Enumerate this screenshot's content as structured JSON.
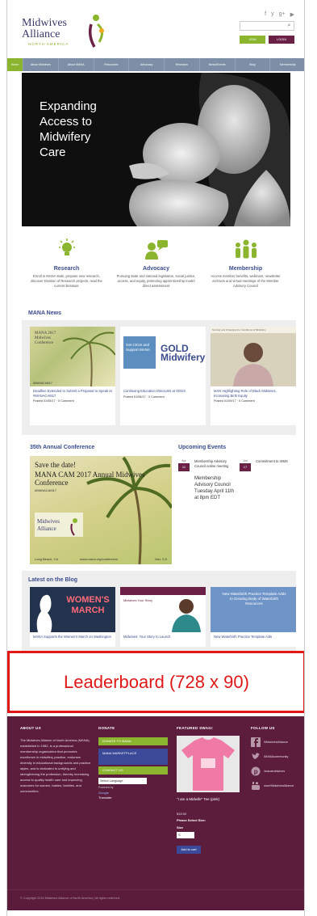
{
  "header": {
    "logo_line1": "Midwives",
    "logo_line2": "Alliance",
    "logo_sub": "NORTH AMERICA",
    "social": [
      "f",
      "y",
      "g+",
      "▶"
    ],
    "join_label": "JOIN",
    "login_label": "LOGIN"
  },
  "nav": [
    "Home",
    "About Midwives",
    "About MANA",
    "Resources",
    "Advocacy",
    "Research",
    "News/Events",
    "Blog",
    "Membership"
  ],
  "hero": {
    "line1": "Expanding",
    "line2": "Access to",
    "line3": "Midwifery",
    "line4": "Care"
  },
  "features": [
    {
      "title": "Research",
      "desc": "Enroll in MANA stats, propose new research, discover Division of Research projects, read the current literature",
      "icon": "lightbulb-icon"
    },
    {
      "title": "Advocacy",
      "desc": "Pursuing state and national legislation, social justice, access, and equity, protecting apprenticeship model direct assessment",
      "icon": "chat-icon"
    },
    {
      "title": "Membership",
      "desc": "Access member benefits, webinars, newsletter archives and virtual meetings of the Member Advisory Council",
      "icon": "people-icon"
    }
  ],
  "news": {
    "title": "MANA News",
    "cards": [
      {
        "title": "Deadline Extended to Submit a Proposal to Speak at #MANACAM17",
        "meta": "Posted 01/05/17 · 0 Comment",
        "img_text": "MANA 2017 Midwives Conference",
        "img_footer": "#MANACAM17"
      },
      {
        "title": "Continuing Education Discounts at SDGS",
        "meta": "Posted 01/08/17 · 0 Comment",
        "img_text": "Get CEUs and Support MANA",
        "img_footer": "GOLD Midwifery"
      },
      {
        "title": "MAN Highlighting Role of Black Midwives, Increasing Birth Equity",
        "meta": "Posted 01/09/17 · 0 Comment",
        "img_text": "Naming and Changing the Conditions of Midwifery",
        "img_footer": ""
      }
    ]
  },
  "conference": {
    "title": "35th Annual Conference",
    "save": "Save the date!",
    "name": "MANA CAM 2017 Annual Midwives Conference",
    "tag": "#MANACAM17",
    "location": "Long Beach, CA",
    "site": "www.mana.org/conference",
    "dates": "Nov. 2-5"
  },
  "events": {
    "title": "Upcoming Events",
    "items": [
      {
        "month": "Apr",
        "day": "11",
        "text": "Membership Advisory Council online meeting",
        "detail": "Membership Advisory Council Tuesday April 11th at 8pm EDT"
      },
      {
        "month": "Jun",
        "day": "17",
        "text": "Commitment to ISMS",
        "detail": ""
      }
    ]
  },
  "blog": {
    "title": "Latest on the Blog",
    "cards": [
      {
        "title": "MANA Supports the Women's March on Washington",
        "img_text": "WOMEN'S MARCH"
      },
      {
        "title": "Midwives: Your Story to Launch",
        "img_text": "Midwives Your Story"
      },
      {
        "title": "New Waterbirth Practice Template Aids",
        "img_text": "New Waterbirth Practice Template Adds to Growing Body of Waterbirth Resources"
      }
    ]
  },
  "leaderboard": "Leaderboard (728 x 90)",
  "footer": {
    "about_head": "ABOUT US",
    "about_text": "The Midwives Alliance of North America (MANA), established in 1982, is a professional membership organization that promotes excellence in midwifery practice, endorses diversity in educational backgrounds and practice styles, and is dedicated to unifying and strengthening the profession, thereby increasing access to quality health care and improving outcomes for women, babies, families, and communities.",
    "donate_head": "DONATE",
    "donate_btn": "DONATE TO MANA",
    "market_btn": "MANA MARKETPLACE",
    "contact_btn": "CONTACT US",
    "language": "Select Language",
    "powered": "Powered by",
    "google": "Google",
    "translate": "Translate",
    "featured_head": "FEATURED SWAG!",
    "shirt_name": "\"I am a Midwife\" Tee (pink)",
    "price": "$15.00",
    "size_note": "Please Select Size:",
    "size_label": "Size",
    "size_value": "S",
    "cart": "Add to cart",
    "follow_head": "FOLLOW US",
    "follow": [
      {
        "text": "/MidwivesAlliance",
        "icon": "facebook-icon"
      },
      {
        "text": "/MANAcommunity",
        "icon": "twitter-icon"
      },
      {
        "text": "/manamidwives",
        "icon": "pinterest-icon"
      },
      {
        "text": "user/MidwivesAlliance",
        "icon": "youtube-icon"
      }
    ],
    "copyright": "© Copyright 2016 Midwives Alliance of North America | All rights reserved."
  },
  "colors": {
    "nav": "#7c8fa6",
    "accent_green": "#8cb52f",
    "brand_purple": "#6b2046",
    "heading_blue": "#3b4c8c",
    "footer": "#5c1d3c",
    "leaderboard_red": "#e01818"
  }
}
